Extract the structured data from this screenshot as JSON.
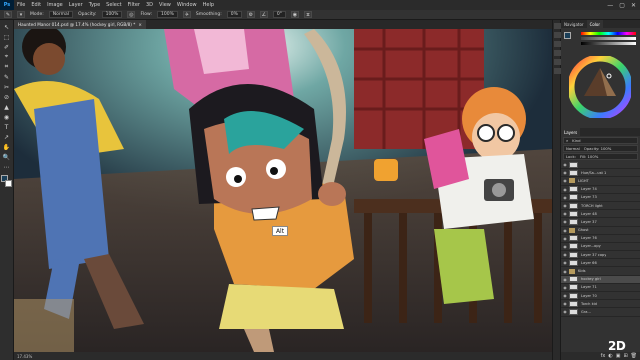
{
  "app": {
    "logo": "Ps"
  },
  "menu": [
    "File",
    "Edit",
    "Image",
    "Layer",
    "Type",
    "Select",
    "Filter",
    "3D",
    "View",
    "Window",
    "Help"
  ],
  "window_controls": [
    "—",
    "▢",
    "✕"
  ],
  "options": {
    "mode_label": "Mode:",
    "mode_value": "Normal",
    "opacity_label": "Opacity:",
    "opacity_value": "100%",
    "flow_label": "Flow:",
    "flow_value": "100%",
    "smoothing_label": "Smoothing:",
    "smoothing_value": "0%",
    "angle_value": "0°"
  },
  "document_tab": {
    "title": "Haunted Manor 014.psd @ 17.4% (hockey girl, RGB/8) *",
    "close": "×"
  },
  "tools": [
    "↖",
    "⬚",
    "✐",
    "⌖",
    "⌗",
    "✎",
    "✂",
    "⊘",
    "▲",
    "◉",
    "T",
    "↗",
    "✋",
    "🔍",
    "⋯"
  ],
  "canvas": {
    "alt_label": "Alt"
  },
  "status": {
    "zoom": "17.43%",
    "doc": ""
  },
  "watermark": "2D",
  "colors": {
    "fg": "#1b3f58",
    "bg": "#ffffff",
    "accent": "#31a8ff"
  },
  "color_panel": {
    "tabs": [
      "Navigator",
      "Color"
    ],
    "active": "Color"
  },
  "layers_panel": {
    "tabs": [
      "Layers"
    ],
    "kind_label": "Kind",
    "blend": "Normal",
    "opacity": "Opacity: 100%",
    "lock": "Lock:",
    "fill": "Fill: 100%",
    "layers": [
      {
        "name": "",
        "kind": "thumb",
        "selected": false
      },
      {
        "name": "Hue/Sa...ust 1",
        "kind": "thumb",
        "selected": false
      },
      {
        "name": "LIGHT",
        "kind": "folder",
        "selected": false
      },
      {
        "name": "Layer 74",
        "kind": "thumb",
        "selected": false
      },
      {
        "name": "Layer 73",
        "kind": "thumb",
        "selected": false
      },
      {
        "name": "TORCH light",
        "kind": "thumb",
        "selected": false
      },
      {
        "name": "Layer 48",
        "kind": "thumb",
        "selected": false
      },
      {
        "name": "Layer 37",
        "kind": "thumb",
        "selected": false
      },
      {
        "name": "Ghost",
        "kind": "folder",
        "selected": false
      },
      {
        "name": "Layer 76",
        "kind": "thumb",
        "selected": false
      },
      {
        "name": "Layer...opy",
        "kind": "thumb",
        "selected": false
      },
      {
        "name": "Layer 37 copy",
        "kind": "thumb",
        "selected": false
      },
      {
        "name": "Layer 66",
        "kind": "thumb",
        "selected": false
      },
      {
        "name": "Kids",
        "kind": "folder",
        "selected": false
      },
      {
        "name": "hockey girl",
        "kind": "thumb",
        "selected": true
      },
      {
        "name": "Layer 71",
        "kind": "thumb",
        "selected": false
      },
      {
        "name": "Layer 70",
        "kind": "thumb",
        "selected": false
      },
      {
        "name": "Torch kid",
        "kind": "thumb",
        "selected": false
      },
      {
        "name": "Gra...",
        "kind": "thumb",
        "selected": false
      }
    ],
    "footer_icons": [
      "fx",
      "◐",
      "▣",
      "⊞",
      "🗑"
    ]
  }
}
